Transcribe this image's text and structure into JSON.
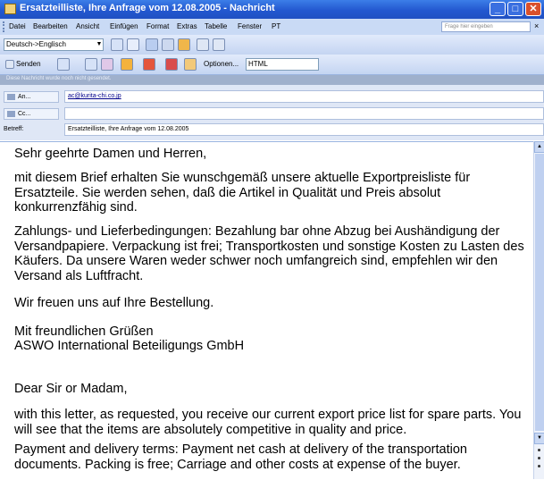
{
  "window": {
    "title": "Ersatzteilliste, Ihre Anfrage vom 12.08.2005 - Nachricht",
    "minimize": "_",
    "maximize": "□",
    "close": "✕"
  },
  "menu": {
    "items": [
      "Datei",
      "Bearbeiten",
      "Ansicht",
      "Einfügen",
      "Format",
      "Extras",
      "Tabelle",
      "Fenster",
      "PT"
    ],
    "help_placeholder": "Frage hier eingeben",
    "close": "×"
  },
  "toolbar1": {
    "translate_selected": "Deutsch->Englisch",
    "icons": [
      "translate-icon",
      "dictionary-icon",
      "layout-icon",
      "grid-icon",
      "picture-icon",
      "document-icon",
      "print-icon"
    ]
  },
  "toolbar2": {
    "send": "Senden",
    "options": "Optionen...",
    "format_selected": "HTML",
    "icons": [
      "attach-icon",
      "address-book-icon",
      "flag-icon",
      "high-importance-icon",
      "low-importance-icon",
      "followup-icon",
      "options-icon"
    ]
  },
  "infobar": {
    "text": "Diese Nachricht wurde noch nicht gesendet."
  },
  "header": {
    "to_label": "An...",
    "to_value": "ac@kurita-chi.co.jp",
    "cc_label": "Cc...",
    "cc_value": "",
    "subject_label": "Betreff:",
    "subject_value": "Ersatzteilliste, Ihre Anfrage vom 12.08.2005"
  },
  "body": {
    "paragraphs": [
      "Sehr geehrte Damen und Herren,",
      "mit diesem Brief erhalten Sie wunschgemäß unsere aktuelle Exportpreisliste für Ersatzteile. Sie werden sehen, daß die Artikel in Qualität und Preis absolut konkurrenzfähig sind.",
      "Zahlungs- und Lieferbedingungen: Bezahlung bar ohne Abzug bei Aushändigung der Versandpapiere. Verpackung ist frei; Transportkosten und sonstige Kosten zu Lasten des Käufers. Da unsere Waren weder schwer noch umfangreich sind, empfehlen wir den Versand als Luftfracht.",
      "Wir freuen uns auf Ihre Bestellung.",
      "Mit freundlichen Grüßen",
      "ASWO International Beteiligungs GmbH",
      "Dear Sir or Madam,",
      "with this letter, as requested, you receive our current export price list for spare parts. You will see that the items are absolutely competitive in quality and price.",
      "Payment and delivery terms: Payment net cash at delivery of the transportation documents. Packing is free; Carriage and other costs at expense of the buyer."
    ]
  },
  "colors": {
    "titlebar": "#2358d0",
    "toolbar": "#c4d5f2",
    "infobar": "#9fb0cc",
    "link": "#00008b"
  }
}
